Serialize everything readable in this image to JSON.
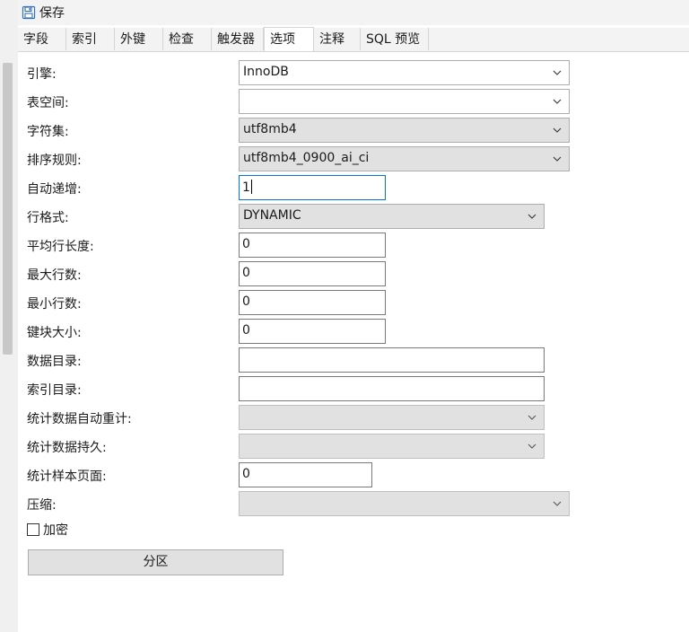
{
  "toolbar": {
    "save_label": "保存",
    "save_icon": "save-icon"
  },
  "tabs": [
    {
      "label": "字段",
      "active": false
    },
    {
      "label": "索引",
      "active": false
    },
    {
      "label": "外键",
      "active": false
    },
    {
      "label": "检查",
      "active": false
    },
    {
      "label": "触发器",
      "active": false
    },
    {
      "label": "选项",
      "active": true
    },
    {
      "label": "注释",
      "active": false
    },
    {
      "label": "SQL 预览",
      "active": false
    }
  ],
  "form": {
    "engine": {
      "label": "引擎:",
      "value": "InnoDB"
    },
    "tablespace": {
      "label": "表空间:",
      "value": ""
    },
    "charset": {
      "label": "字符集:",
      "value": "utf8mb4"
    },
    "collation": {
      "label": "排序规则:",
      "value": "utf8mb4_0900_ai_ci"
    },
    "auto_increment": {
      "label": "自动递增:",
      "value": "1"
    },
    "row_format": {
      "label": "行格式:",
      "value": "DYNAMIC"
    },
    "avg_row_length": {
      "label": "平均行长度:",
      "value": "0"
    },
    "max_rows": {
      "label": "最大行数:",
      "value": "0"
    },
    "min_rows": {
      "label": "最小行数:",
      "value": "0"
    },
    "key_block_size": {
      "label": "键块大小:",
      "value": "0"
    },
    "data_directory": {
      "label": "数据目录:",
      "value": ""
    },
    "index_directory": {
      "label": "索引目录:",
      "value": ""
    },
    "stats_auto_recalc": {
      "label": "统计数据自动重计:",
      "value": ""
    },
    "stats_persistent": {
      "label": "统计数据持久:",
      "value": ""
    },
    "stats_sample_pages": {
      "label": "统计样本页面:",
      "value": "0"
    },
    "compression": {
      "label": "压缩:",
      "value": ""
    }
  },
  "encryption": {
    "label": "加密",
    "checked": false
  },
  "partition_button": {
    "label": "分区"
  },
  "colors": {
    "accent_focus": "#0078d7",
    "save_icon": "#2e6fb5"
  }
}
